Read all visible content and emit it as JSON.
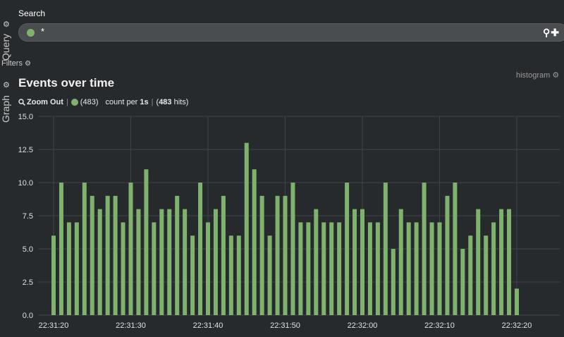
{
  "side_tabs": {
    "query": "Query",
    "filters": "Filters",
    "graph": "Graph"
  },
  "search": {
    "title": "Search",
    "query_value": "*",
    "query_color": "#7eb26d"
  },
  "panel": {
    "title": "Events over time",
    "type_label": "histogram"
  },
  "legend": {
    "zoom_out": "Zoom Out",
    "series_count": "(483)",
    "count_per_prefix": "count per ",
    "interval": "1s",
    "hits_open": "(",
    "hits_value": "483",
    "hits_close": " hits)"
  },
  "icons": {
    "gear": "gear-icon",
    "search": "search-icon",
    "plus": "plus-icon",
    "zoom": "zoom-out-icon"
  },
  "chart_data": {
    "type": "bar",
    "title": "Events over time",
    "color": "#7eb26d",
    "ylim": [
      0,
      15
    ],
    "yticks": [
      "0.0",
      "2.5",
      "5.0",
      "7.5",
      "10.0",
      "12.5",
      "15.0"
    ],
    "xticks": [
      "22:31:20",
      "22:31:30",
      "22:31:40",
      "22:31:50",
      "22:32:00",
      "22:32:10",
      "22:32:20"
    ],
    "values": [
      6,
      10,
      7,
      7,
      10,
      9,
      8,
      9,
      9,
      7,
      10,
      8,
      11,
      7,
      8,
      8,
      9,
      8,
      6,
      10,
      7,
      8,
      9,
      6,
      6,
      13,
      11,
      9,
      6,
      9,
      9,
      10,
      7,
      7,
      8,
      7,
      7,
      7,
      10,
      8,
      8,
      7,
      7,
      10,
      5,
      8,
      7,
      7,
      10,
      7,
      7,
      9,
      10,
      5,
      6,
      8,
      6,
      7,
      8,
      8,
      2
    ],
    "grid": true
  }
}
